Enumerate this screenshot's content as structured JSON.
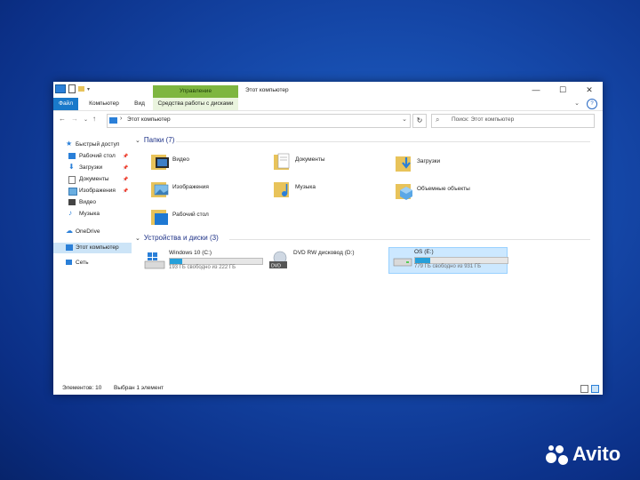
{
  "window": {
    "title": "Этот компьютер",
    "context_tab": "Управление",
    "ribbon": {
      "file": "Файл",
      "computer": "Компьютер",
      "view": "Вид",
      "disk_tools": "Средства работы с дисками"
    },
    "address_path": "Этот компьютер",
    "search_placeholder": "Поиск: Этот компьютер"
  },
  "nav": {
    "quick_access": "Быстрый доступ",
    "items": [
      {
        "label": "Рабочий стол",
        "pinned": true
      },
      {
        "label": "Загрузки",
        "pinned": true
      },
      {
        "label": "Документы",
        "pinned": true
      },
      {
        "label": "Изображения",
        "pinned": true
      },
      {
        "label": "Видео",
        "pinned": false
      },
      {
        "label": "Музыка",
        "pinned": false
      }
    ],
    "onedrive": "OneDrive",
    "this_pc": "Этот компьютер",
    "network": "Сеть"
  },
  "folders": {
    "header": "Папки (7)",
    "items": [
      "Видео",
      "Документы",
      "Загрузки",
      "Изображения",
      "Музыка",
      "Объемные объекты",
      "Рабочий стол"
    ]
  },
  "drives": {
    "header": "Устройства и диски (3)",
    "items": [
      {
        "name": "Windows 10 (C:)",
        "free": "193 ГБ свободно из 222 ГБ",
        "used_fraction": 0.13
      },
      {
        "name": "DVD RW дисковод (D:)",
        "free": "",
        "used_fraction": null
      },
      {
        "name": "OS (E:)",
        "free": "779 ГБ свободно из 931 ГБ",
        "used_fraction": 0.16
      }
    ]
  },
  "status": {
    "count": "Элементов: 10",
    "selected": "Выбран 1 элемент"
  },
  "watermark": "Avito",
  "colors": {
    "accent": "#1979ca",
    "context_tab": "#7eb640",
    "selection": "#cce8ff",
    "drive_bar": "#26a0da"
  }
}
